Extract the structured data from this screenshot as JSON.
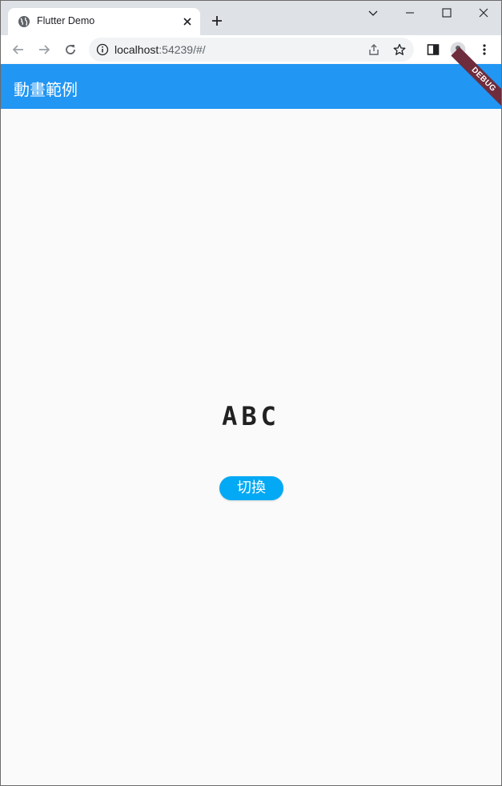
{
  "browser": {
    "tab": {
      "title": "Flutter Demo",
      "icon": "globe-icon"
    },
    "address": {
      "host": "localhost",
      "rest": ":54239/#/"
    }
  },
  "app": {
    "title": "動畫範例",
    "debug_banner": "DEBUG",
    "colors": {
      "appbar": "#2196f3",
      "button": "#03a9f4",
      "background": "#fafafa"
    }
  },
  "content": {
    "animated_text": "ABC",
    "toggle_button": "切換"
  }
}
